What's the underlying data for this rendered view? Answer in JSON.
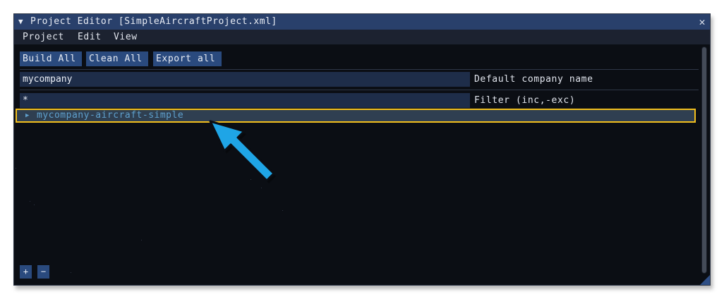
{
  "window": {
    "title": "Project Editor [SimpleAircraftProject.xml]",
    "collapse_glyph": "▼",
    "close_glyph": "✕"
  },
  "menu": {
    "items": [
      "Project",
      "Edit",
      "View"
    ]
  },
  "toolbar": {
    "build_all": "Build All",
    "clean_all": "Clean All",
    "export_all": "Export all"
  },
  "company": {
    "value": "mycompany",
    "label": "Default company name"
  },
  "filter": {
    "value": "*",
    "label": "Filter (inc,-exc)"
  },
  "tree": {
    "items": [
      {
        "label": "mycompany-aircraft-simple",
        "expanded": false,
        "selected": true
      }
    ]
  },
  "footer": {
    "add": "+",
    "remove": "−"
  },
  "annotation": {
    "arrow_color": "#1fa5e6",
    "highlight_color": "#f2bf1d",
    "icon": "arrow-pointer-icon"
  }
}
